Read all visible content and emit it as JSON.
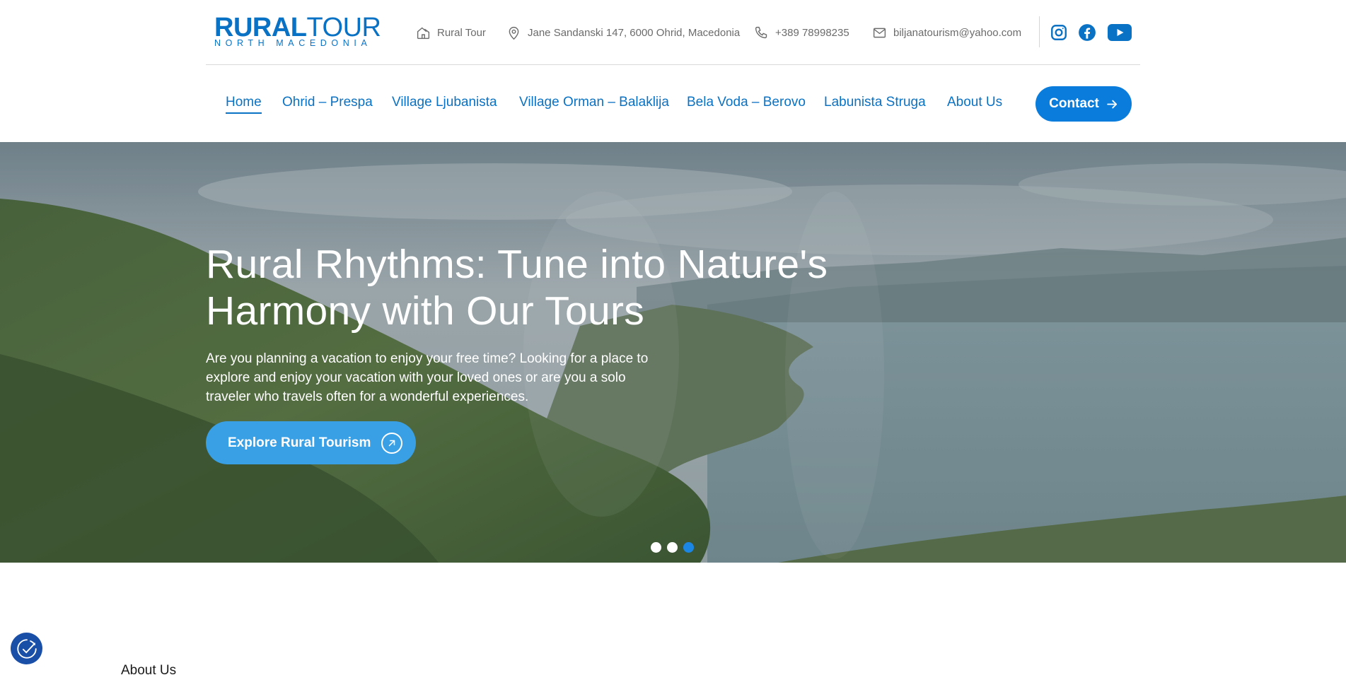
{
  "logo": {
    "line1_bold": "RURAL",
    "line1_light": "TOUR",
    "line2": "NORTH MACEDONIA"
  },
  "topbar": {
    "company": "Rural Tour",
    "address": "Jane Sandanski 147, 6000 Ohrid, Macedonia",
    "phone": "+389 78998235",
    "email": "biljanatourism@yahoo.com"
  },
  "social": [
    "instagram-icon",
    "facebook-icon",
    "youtube-icon"
  ],
  "nav": {
    "items": [
      {
        "label": "Home",
        "active": true
      },
      {
        "label": "Ohrid – Prespa",
        "active": false
      },
      {
        "label": "Village Ljubanista",
        "active": false
      },
      {
        "label": "Village Orman – Balaklija",
        "active": false
      },
      {
        "label": "Bela Voda – Berovo",
        "active": false
      },
      {
        "label": "Labunista Struga",
        "active": false
      },
      {
        "label": "About Us",
        "active": false
      }
    ],
    "contact_label": "Contact"
  },
  "hero": {
    "title": "Rural Rhythms: Tune into Nature's Harmony with Our Tours",
    "text": "Are you planning a vacation to enjoy your free time? Looking for a place to explore and enjoy your vacation with your loved ones or are you a solo traveler who travels often for a wonderful experiences.",
    "button_label": "Explore Rural Tourism",
    "slides": 3,
    "active_slide": 3
  },
  "section": {
    "label": "About Us"
  },
  "colors": {
    "brand": "#0a72c4",
    "button": "#0a7ddc",
    "hero_button": "#3aa0e6",
    "dot_active": "#1c86e4",
    "accessibility": "#1a4fa8"
  }
}
